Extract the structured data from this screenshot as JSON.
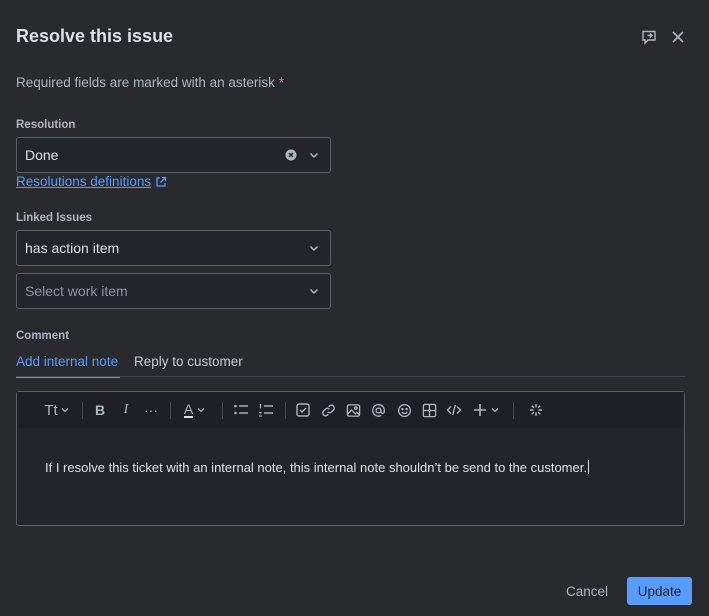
{
  "dialog": {
    "title": "Resolve this issue",
    "required_note": "Required fields are marked with an asterisk",
    "required_marker": "*"
  },
  "resolution": {
    "label": "Resolution",
    "value": "Done",
    "link": "Resolutions definitions"
  },
  "linked_issues": {
    "label": "Linked Issues",
    "link_type": "has action item",
    "work_item_placeholder": "Select work item"
  },
  "comment": {
    "label": "Comment",
    "tabs": [
      {
        "label": "Add internal note",
        "active": true
      },
      {
        "label": "Reply to customer",
        "active": false
      }
    ],
    "toolbar": {
      "text_style": "Tt",
      "bold": "B",
      "italic": "I",
      "more": "···",
      "color": "A"
    },
    "text": "If I resolve this ticket with an internal note, this internal note shouldn’t be send to the customer."
  },
  "footer": {
    "cancel": "Cancel",
    "update": "Update"
  },
  "colors": {
    "background": "#282a2e",
    "accent": "#579dff",
    "required": "#f87462"
  }
}
